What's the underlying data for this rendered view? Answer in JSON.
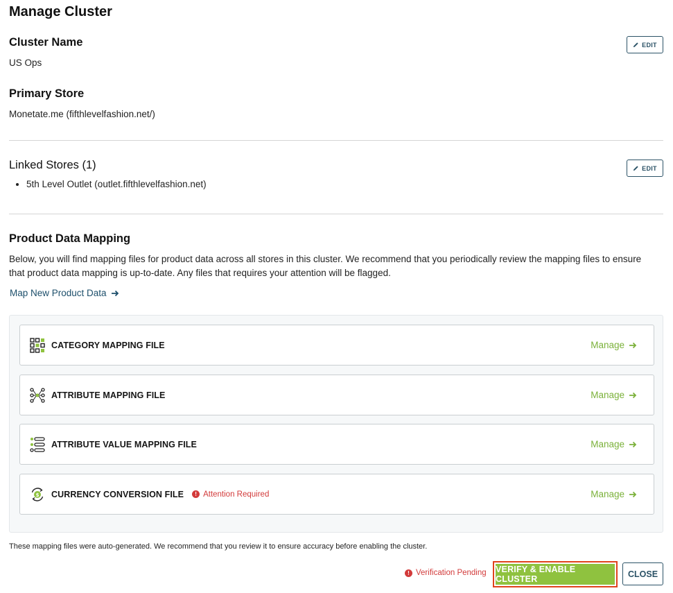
{
  "page": {
    "title": "Manage Cluster"
  },
  "cluster_name": {
    "heading": "Cluster Name",
    "value": "US Ops",
    "edit_label": "EDIT"
  },
  "primary_store": {
    "heading": "Primary Store",
    "value": "Monetate.me (fifthlevelfashion.net/)"
  },
  "linked_stores": {
    "heading": "Linked Stores (1)",
    "edit_label": "EDIT",
    "items": [
      "5th Level Outlet (outlet.fifthlevelfashion.net)"
    ]
  },
  "product_data_mapping": {
    "heading": "Product Data Mapping",
    "description": "Below, you will find mapping files for product data across all stores in this cluster. We recommend that you periodically review the mapping files to ensure that product data mapping is up-to-date. Any files that requires your attention will be flagged.",
    "map_new_label": "Map New Product Data",
    "files": [
      {
        "label": "CATEGORY MAPPING FILE",
        "icon": "grid-icon",
        "manage_label": "Manage",
        "flag": ""
      },
      {
        "label": "ATTRIBUTE MAPPING FILE",
        "icon": "nodes-icon",
        "manage_label": "Manage",
        "flag": ""
      },
      {
        "label": "ATTRIBUTE VALUE MAPPING FILE",
        "icon": "list-icon",
        "manage_label": "Manage",
        "flag": ""
      },
      {
        "label": "CURRENCY CONVERSION FILE",
        "icon": "currency-refresh-icon",
        "manage_label": "Manage",
        "flag": "Attention Required"
      }
    ]
  },
  "footer": {
    "note": "These mapping files were auto-generated. We recommend that you review it to ensure accuracy before enabling the cluster.",
    "status": "Verification Pending",
    "verify_label": "VERIFY & ENABLE CLUSTER",
    "close_label": "CLOSE"
  },
  "colors": {
    "accent_green": "#8fc23f",
    "link_green": "#7bb13a",
    "navy": "#2b5266",
    "alert_red": "#d23a3a",
    "highlight_border": "#e0421b"
  }
}
